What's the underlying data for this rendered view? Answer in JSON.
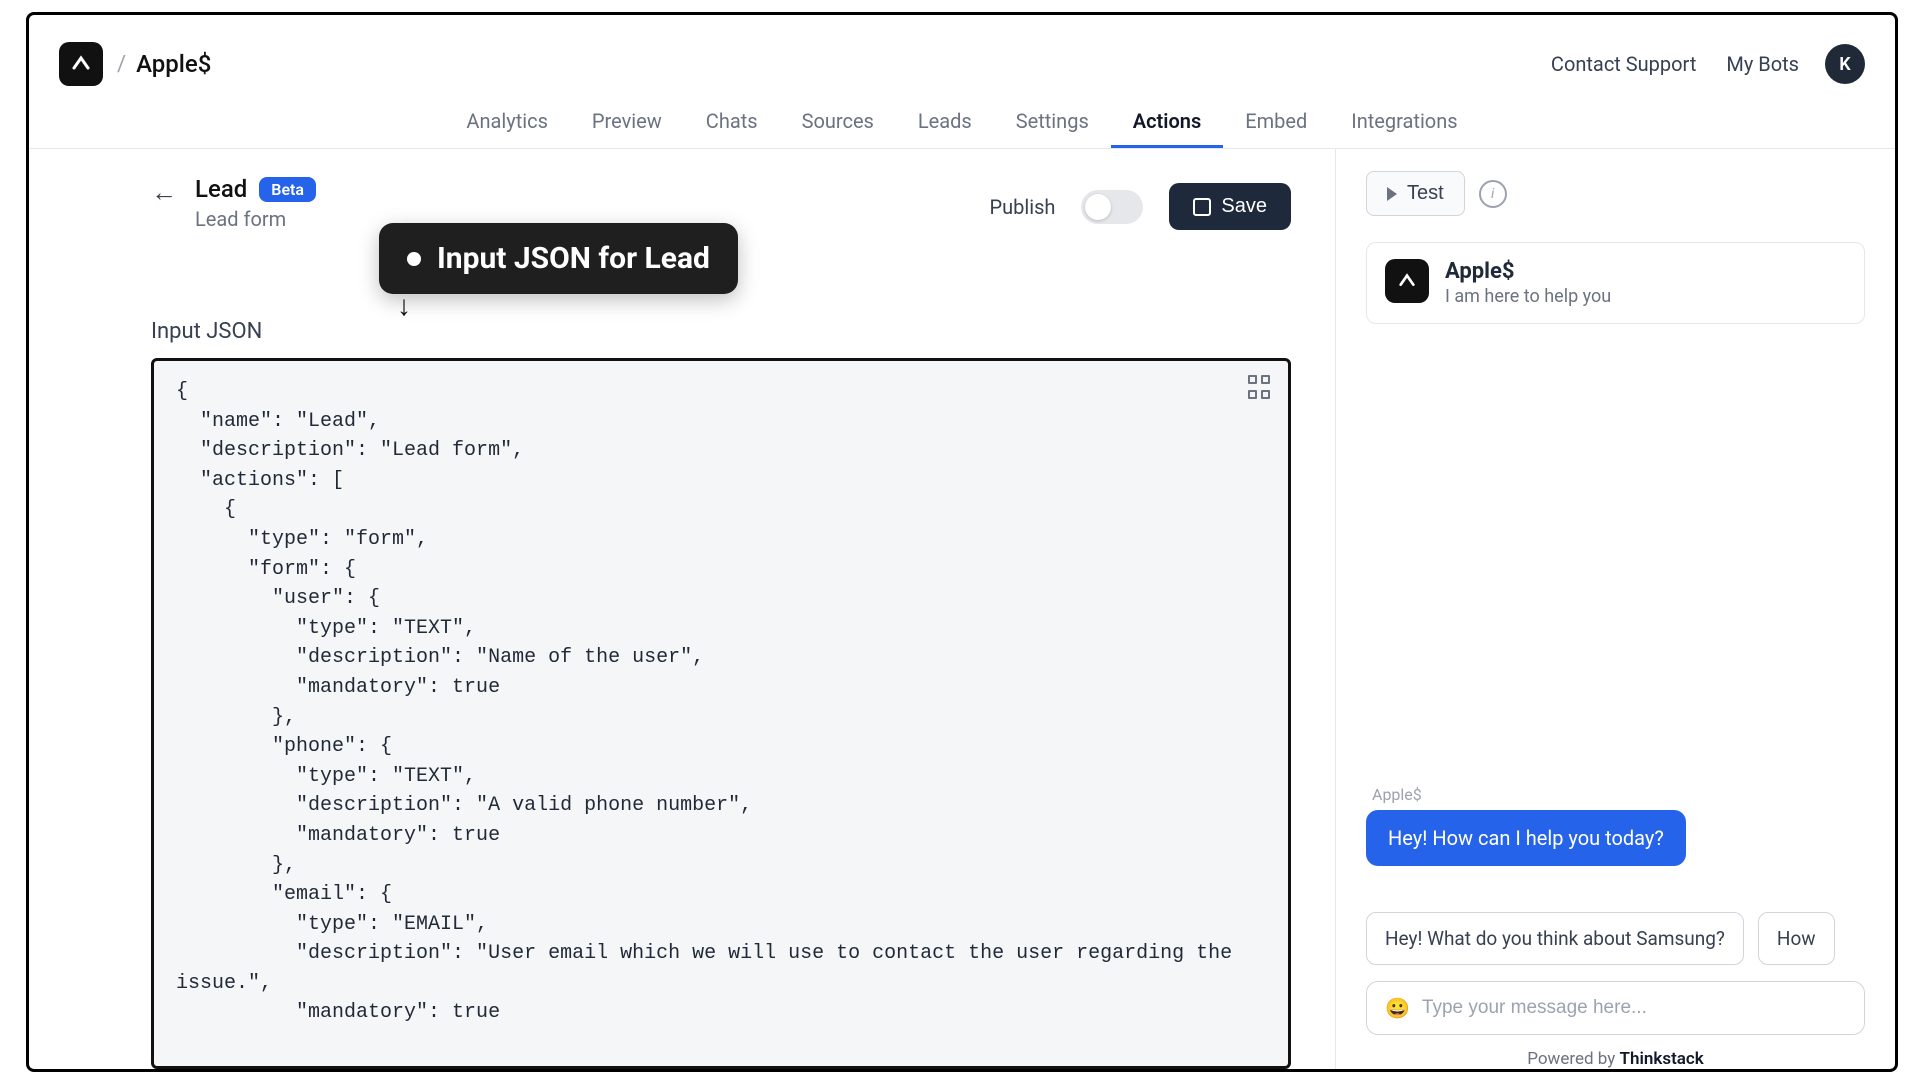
{
  "header": {
    "breadcrumb_slash": "/",
    "bot_name": "Apple$",
    "contact_support": "Contact Support",
    "my_bots": "My Bots",
    "avatar_initial": "K"
  },
  "tabs": [
    {
      "label": "Analytics",
      "active": false
    },
    {
      "label": "Preview",
      "active": false
    },
    {
      "label": "Chats",
      "active": false
    },
    {
      "label": "Sources",
      "active": false
    },
    {
      "label": "Leads",
      "active": false
    },
    {
      "label": "Settings",
      "active": false
    },
    {
      "label": "Actions",
      "active": true
    },
    {
      "label": "Embed",
      "active": false
    },
    {
      "label": "Integrations",
      "active": false
    }
  ],
  "lead_header": {
    "title": "Lead",
    "badge": "Beta",
    "subtitle": "Lead form",
    "publish_label": "Publish",
    "publish_on": false,
    "save_label": "Save"
  },
  "callout": {
    "text": "Input JSON for Lead"
  },
  "left_panel": {
    "input_json_label": "Input JSON",
    "code": "{\n  \"name\": \"Lead\",\n  \"description\": \"Lead form\",\n  \"actions\": [\n    {\n      \"type\": \"form\",\n      \"form\": {\n        \"user\": {\n          \"type\": \"TEXT\",\n          \"description\": \"Name of the user\",\n          \"mandatory\": true\n        },\n        \"phone\": {\n          \"type\": \"TEXT\",\n          \"description\": \"A valid phone number\",\n          \"mandatory\": true\n        },\n        \"email\": {\n          \"type\": \"EMAIL\",\n          \"description\": \"User email which we will use to contact the user regarding the issue.\",\n          \"mandatory\": true"
  },
  "right_panel": {
    "test_label": "Test",
    "chat_title": "Apple$",
    "chat_subtitle": "I am here to help you",
    "chat_from": "Apple$",
    "chat_message": "Hey! How can I help you today?",
    "suggestions": [
      "Hey! What do you think about Samsung?",
      "How"
    ],
    "input_placeholder": "Type your message here...",
    "powered_by_prefix": "Powered by ",
    "powered_by_brand": "Thinkstack"
  }
}
